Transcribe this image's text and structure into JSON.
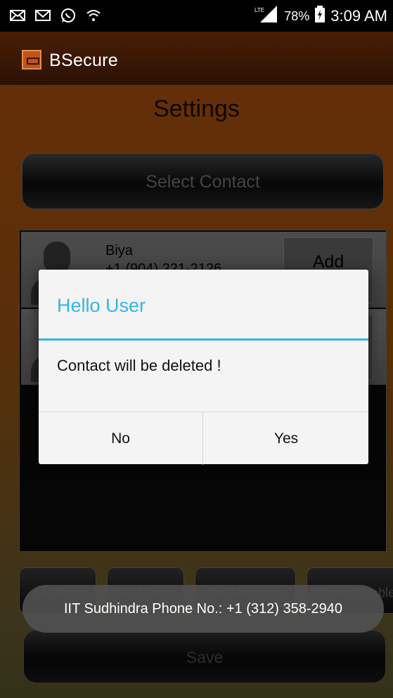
{
  "status_bar": {
    "network": "LTE",
    "battery": "78%",
    "time": "3:09 AM",
    "icons": [
      "mail-icon",
      "gmail-icon",
      "whatsapp-icon",
      "wifi-icon",
      "signal-icon",
      "battery-charging-icon"
    ]
  },
  "app_bar": {
    "title": "BSecure"
  },
  "settings": {
    "title": "Settings",
    "select_contact_label": "Select Contact",
    "contacts": [
      {
        "name": "Biya",
        "phone": "+1 (904) 221-2126",
        "action": "Add"
      },
      {
        "name": "",
        "phone": "",
        "action": ""
      }
    ],
    "bottom_buttons": [
      "Set Hour",
      "Set Minute",
      "Set Message",
      "Shake Enable"
    ],
    "save_label": "Save"
  },
  "dialog": {
    "title": "Hello User",
    "message": "Contact will be deleted !",
    "no_label": "No",
    "yes_label": "Yes"
  },
  "toast": {
    "text": "IIT Sudhindra   Phone No.: +1 (312) 358-2940"
  },
  "colors": {
    "accent": "#33b5e5",
    "background_top": "#b8570f",
    "app_bar": "#3a1607"
  }
}
